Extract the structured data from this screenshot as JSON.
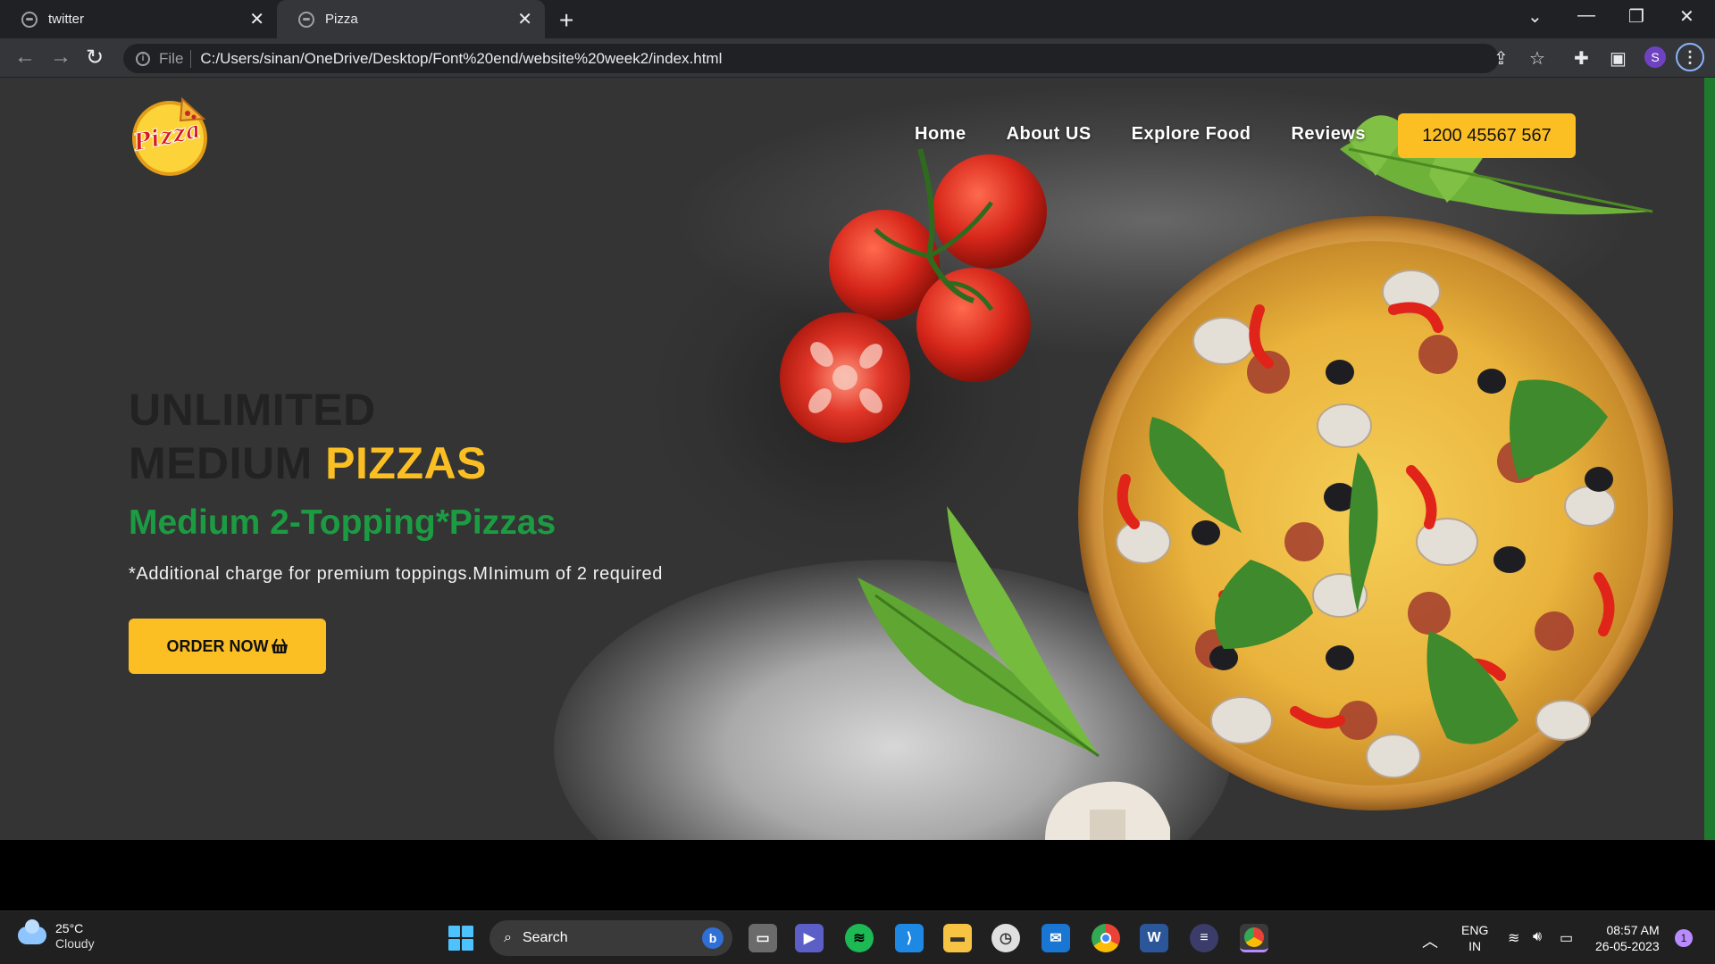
{
  "browser": {
    "tabs": [
      {
        "title": "twitter",
        "active": false
      },
      {
        "title": "Pizza",
        "active": true
      }
    ],
    "omnibox": {
      "scheme_label": "File",
      "url": "C:/Users/sinan/OneDrive/Desktop/Font%20end/website%20week2/index.html"
    },
    "profile_initial": "S"
  },
  "page": {
    "logo_text": "Pizza",
    "nav": [
      "Home",
      "About US",
      "Explore Food",
      "Reviews"
    ],
    "phone": "1200 45567 567",
    "headline_line1": "UNLIMITED",
    "headline_line2": "MEDIUM",
    "headline_accent": "PIZZAS",
    "subheadline": "Medium 2-Topping*Pizzas",
    "note": "*Additional charge for premium toppings.MInimum of 2 required",
    "order_button": "ORDER NOW",
    "colors": {
      "accent": "#fbbf24",
      "green": "#1c9c42",
      "background": "#343434"
    }
  },
  "taskbar": {
    "weather": {
      "temp": "25°C",
      "condition": "Cloudy"
    },
    "search_label": "Search",
    "language": {
      "line1": "ENG",
      "line2": "IN"
    },
    "clock": {
      "time": "08:57 AM",
      "date": "26-05-2023"
    },
    "notifications": "1",
    "apps": [
      "task-view",
      "teams-meet",
      "spotify",
      "vscode",
      "file-explorer",
      "clock-app",
      "mail",
      "chrome",
      "word",
      "media-app",
      "chrome-profile"
    ]
  }
}
